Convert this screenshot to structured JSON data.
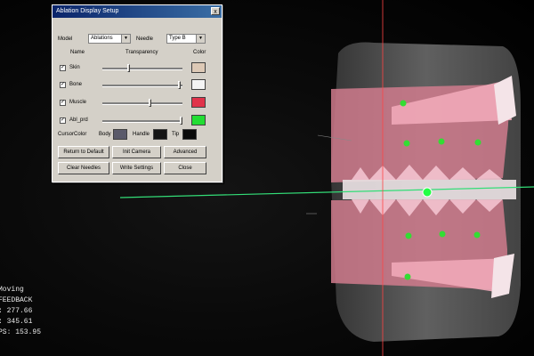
{
  "window": {
    "title": "Ablation Display Setup",
    "close_label": "x"
  },
  "model_row": {
    "model_label": "Model",
    "model_value": "Ablations",
    "needle_label": "Needle",
    "needle_value": "Type B"
  },
  "headers": {
    "name": "Name",
    "transparency": "Transparency",
    "color": "Color"
  },
  "layers": [
    {
      "name": "Skin",
      "checked": true,
      "transparency": 0.32,
      "color": "#ddc9b6"
    },
    {
      "name": "Bone",
      "checked": true,
      "transparency": 0.98,
      "color": "#f4f4f4"
    },
    {
      "name": "Muscle",
      "checked": true,
      "transparency": 0.6,
      "color": "#e0334a"
    },
    {
      "name": "Abl_prd",
      "checked": true,
      "transparency": 1.0,
      "color": "#22dd33"
    }
  ],
  "cursor_colors": {
    "label": "CursorColor",
    "body_label": "Body",
    "body_color": "#5a5a6a",
    "handle_label": "Handle",
    "handle_color": "#151515",
    "tip_label": "Tip",
    "tip_color": "#0a0a0a"
  },
  "buttons": {
    "return_default": "Return to Default",
    "init_camera": "Init Camera",
    "advanced": "Advanced",
    "clear_needles": "Clear Needles",
    "write_settings": "Write Settings",
    "close": "Close"
  },
  "status": {
    "line1": "Moving",
    "line2": "FEEDBACK",
    "line3": ": 277.66",
    "line4": ": 345.61",
    "line5": "PS: 153.95"
  },
  "colors": {
    "crosshair": "#ff4444",
    "needle": "#33dd77",
    "markers": "#33dd33",
    "ablation_zone": "#e88aa0"
  }
}
